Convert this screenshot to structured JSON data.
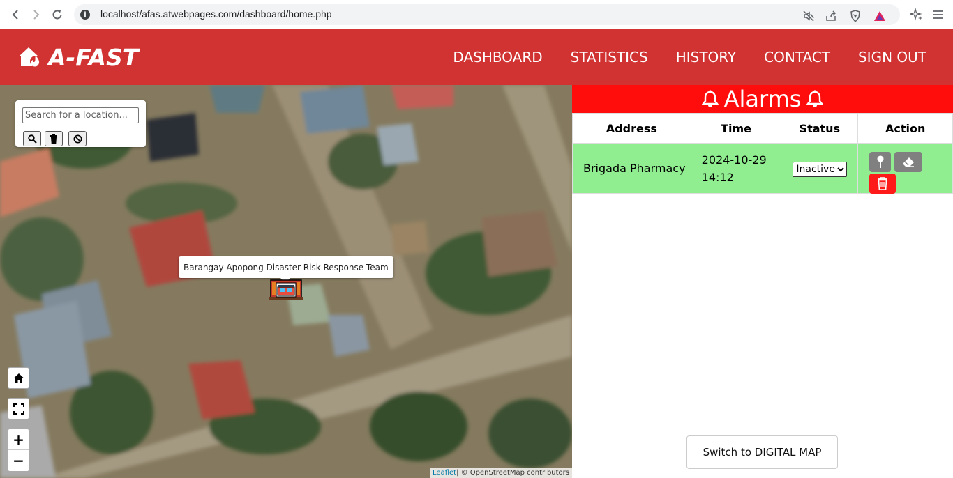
{
  "browser": {
    "url": "localhost/afas.atwebpages.com/dashboard/home.php",
    "info_icon": "info-icon"
  },
  "header": {
    "logo_text": "A-FAST",
    "logo_icon": "house-fire-icon",
    "menu": [
      "DASHBOARD",
      "STATISTICS",
      "HISTORY",
      "CONTACT",
      "SIGN OUT"
    ],
    "bg_color": "#d13333"
  },
  "map": {
    "search_placeholder": "Search for a location...",
    "tooltip": "Barangay Apopong Disaster Risk Response Team",
    "zoom_in": "+",
    "zoom_out": "−",
    "attribution_link": "Leaflet",
    "attribution_text": " | © OpenStreetMap contributors"
  },
  "alarms": {
    "title": "Alarms",
    "title_bg": "#ff0d0d",
    "row_bg": "#90ee90",
    "columns": [
      "Address",
      "Time",
      "Status",
      "Action"
    ],
    "rows": [
      {
        "address": "Brigada Pharmacy",
        "time": "2024-10-29 14:12",
        "status": "Inactive",
        "status_options": [
          "Inactive"
        ]
      }
    ]
  },
  "switch_button": "Switch to DIGITAL MAP"
}
